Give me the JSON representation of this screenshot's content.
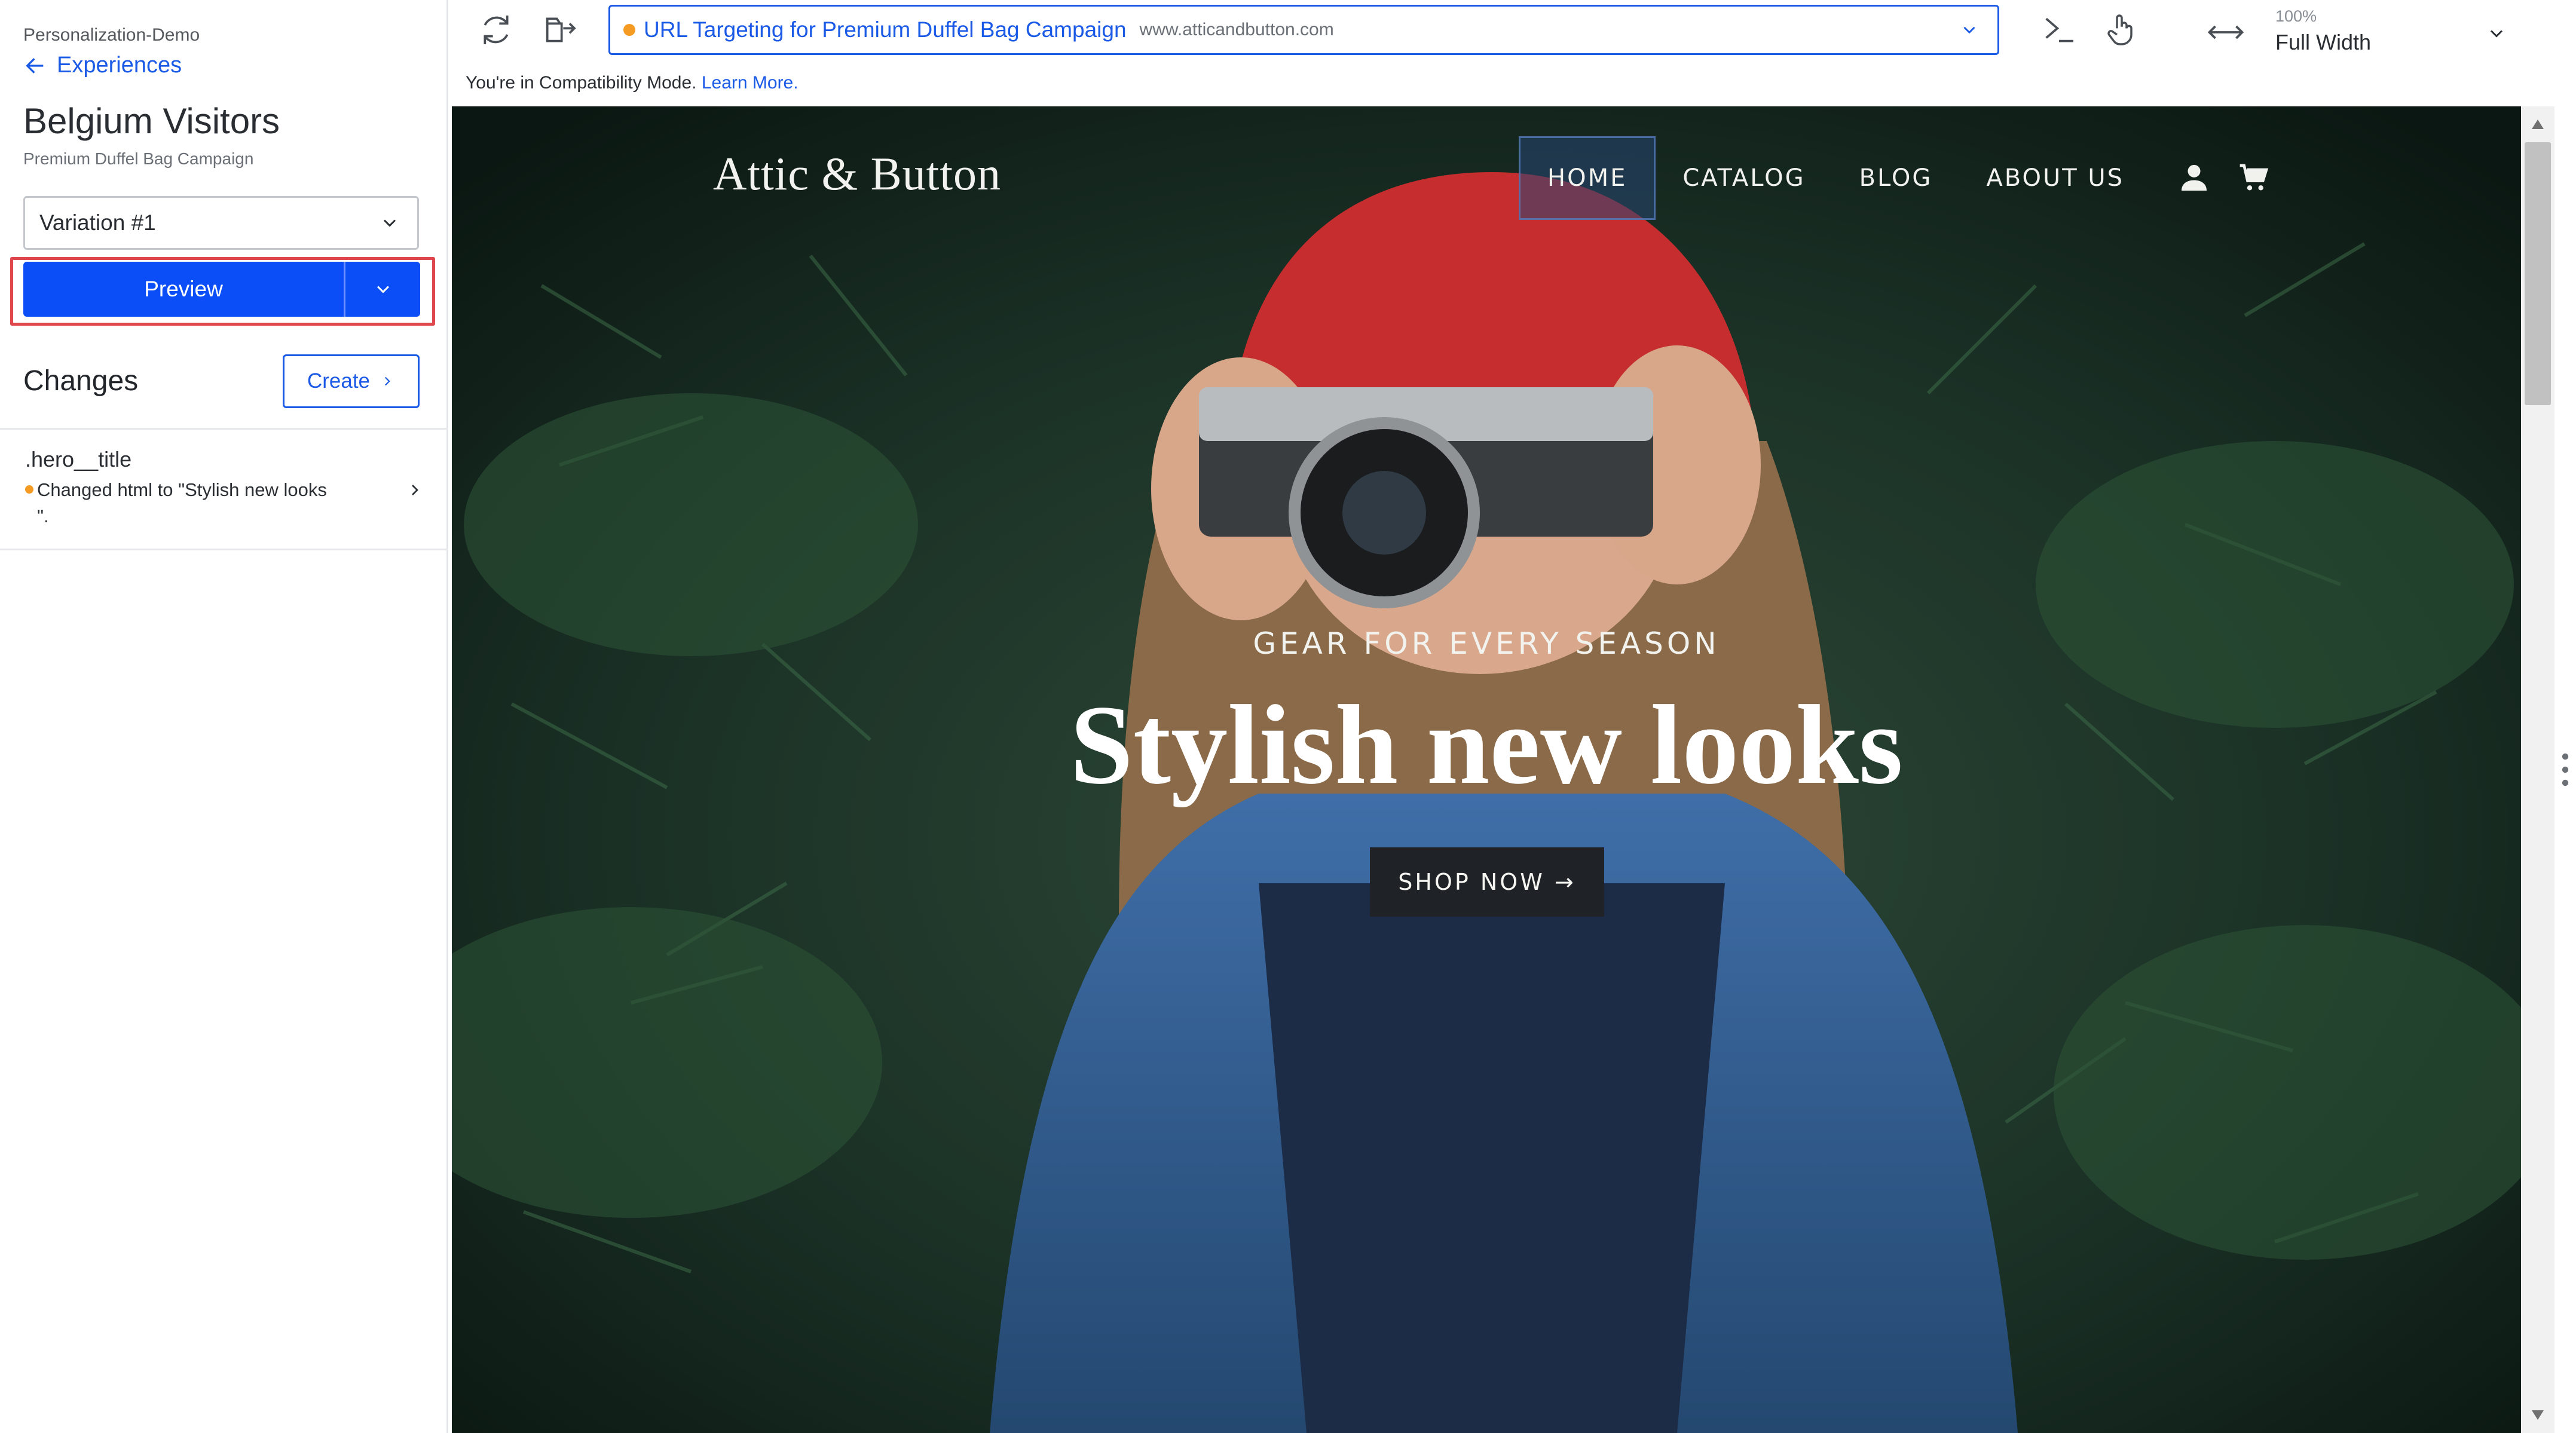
{
  "sidebar": {
    "workspace": "Personalization-Demo",
    "back_label": "Experiences",
    "experience_title": "Belgium Visitors",
    "campaign": "Premium Duffel Bag Campaign",
    "variation": "Variation #1",
    "preview_label": "Preview",
    "changes_heading": "Changes",
    "create_label": "Create",
    "changes": [
      {
        "selector": ".hero__title",
        "description": "Changed html to \"Stylish new looks\n\".",
        "status_color": "#f59b23"
      }
    ]
  },
  "toolbar": {
    "url_name": "URL Targeting for Premium Duffel Bag Campaign",
    "url_host": "www.atticandbutton.com",
    "zoom_percent": "100%",
    "zoom_mode": "Full Width",
    "icons": [
      "refresh-icon",
      "open-external-icon",
      "terminal-icon",
      "pointer-hand-icon",
      "resize-arrows-icon"
    ]
  },
  "compat": {
    "text": "You're in Compatibility Mode.",
    "link": "Learn More."
  },
  "site": {
    "logo": "Attic & Button",
    "nav": [
      "HOME",
      "CATALOG",
      "BLOG",
      "ABOUT US"
    ],
    "active_nav": "HOME",
    "kicker": "GEAR FOR EVERY SEASON",
    "title": "Stylish new looks",
    "cta": "SHOP NOW →"
  },
  "colors": {
    "accent": "#1a5ae6",
    "preview_button": "#0b4ef7",
    "highlight": "#e0474c",
    "status_dot": "#f59b23"
  }
}
